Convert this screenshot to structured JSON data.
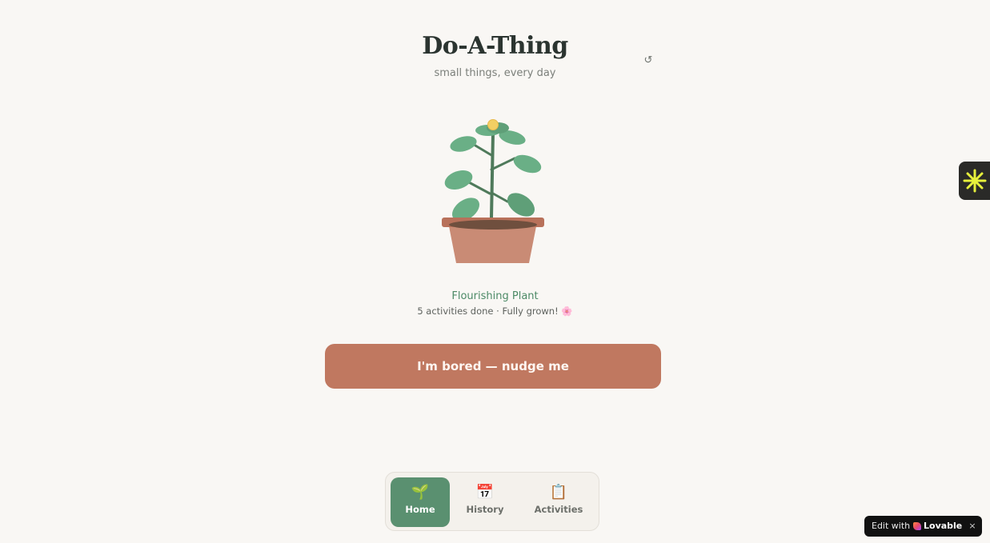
{
  "header": {
    "title": "Do-A-Thing",
    "subtitle": "small things, every day",
    "reset_icon": "↺"
  },
  "plant": {
    "name": "Flourishing Plant",
    "status": "5 activities done · Fully grown! 🌸",
    "icon": "potted-plant-illustration",
    "colors": {
      "leaf": "#6aaf86",
      "stem": "#4f7a5b",
      "flower": "#f2cf63",
      "pot": "#c98b75",
      "pot_rim": "#b8715a",
      "soil": "#6f4f3e"
    }
  },
  "nudge_button": {
    "label": "I'm bored — nudge me",
    "color": "#c07860"
  },
  "nav": {
    "items": [
      {
        "label": "Home",
        "icon": "🌱",
        "active": true
      },
      {
        "label": "History",
        "icon": "📅"
      },
      {
        "label": "Activities",
        "icon": "📋"
      }
    ],
    "active_color": "#5a9070"
  },
  "overlay": {
    "edit_label": "Edit with",
    "brand": "Lovable",
    "close": "×"
  }
}
